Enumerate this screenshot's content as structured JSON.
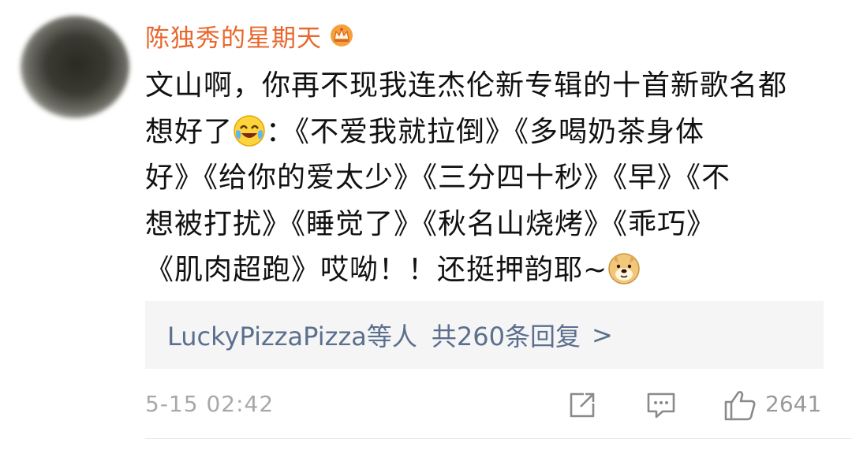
{
  "comment": {
    "username": "陈独秀的星期天",
    "badge_icon": "crown-badge-icon",
    "lines": [
      "文山啊，你再不现我连杰伦新专辑的十首新歌名都",
      "想好了",
      "：《不爱我就拉倒》《多喝奶茶身体",
      "好》《给你的爱太少》《三分四十秒》《早》《不",
      "想被打扰》《睡觉了》《秋名山烧烤》《乖巧》",
      "《肌肉超跑》哎呦！！还挺押韵耶~"
    ],
    "emojis": [
      "laughing-crying-emoji",
      "doge-emoji"
    ],
    "replies": {
      "users": "LuckyPizzaPizza等人",
      "count_text": "共260条回复",
      "chevron": ">"
    },
    "timestamp": "5-15 02:42",
    "like_count": "2641"
  },
  "colors": {
    "username": "#e8672c",
    "reply_link": "#5b6f8e",
    "reply_bg": "#f5f5f5",
    "meta_text": "#a8a8a8"
  }
}
